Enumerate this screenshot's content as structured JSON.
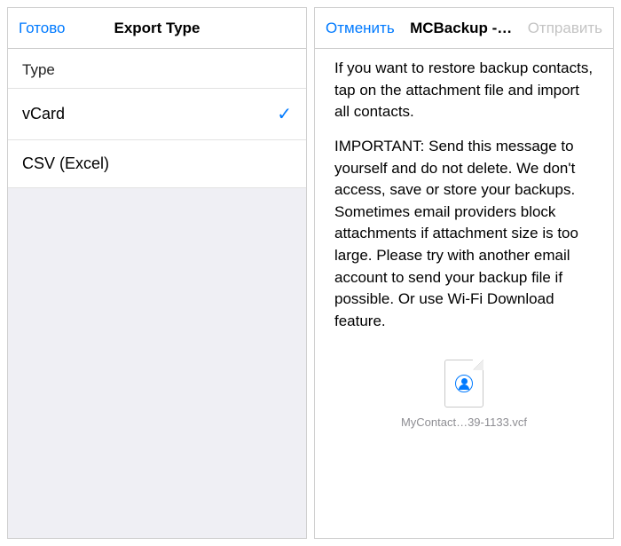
{
  "left": {
    "nav": {
      "done": "Готово",
      "title": "Export Type"
    },
    "section_header": "Type",
    "rows": {
      "vcard": {
        "label": "vCard",
        "selected": true
      },
      "csv": {
        "label": "CSV (Excel)",
        "selected": false
      }
    }
  },
  "right": {
    "nav": {
      "cancel": "Отменить",
      "title": "MCBackup -…",
      "send": "Отправить"
    },
    "body": {
      "p1": "If you want to restore backup contacts, tap on the attachment file and import all contacts.",
      "p2": "IMPORTANT: Send this message to yourself and do not delete. We don't access, save or store your backups. Sometimes email providers block attachments if attachment size is too large. Please try with another email account to send your backup file if possible. Or use Wi-Fi Download feature."
    },
    "attachment": {
      "filename": "MyContact…39-1133.vcf"
    }
  }
}
